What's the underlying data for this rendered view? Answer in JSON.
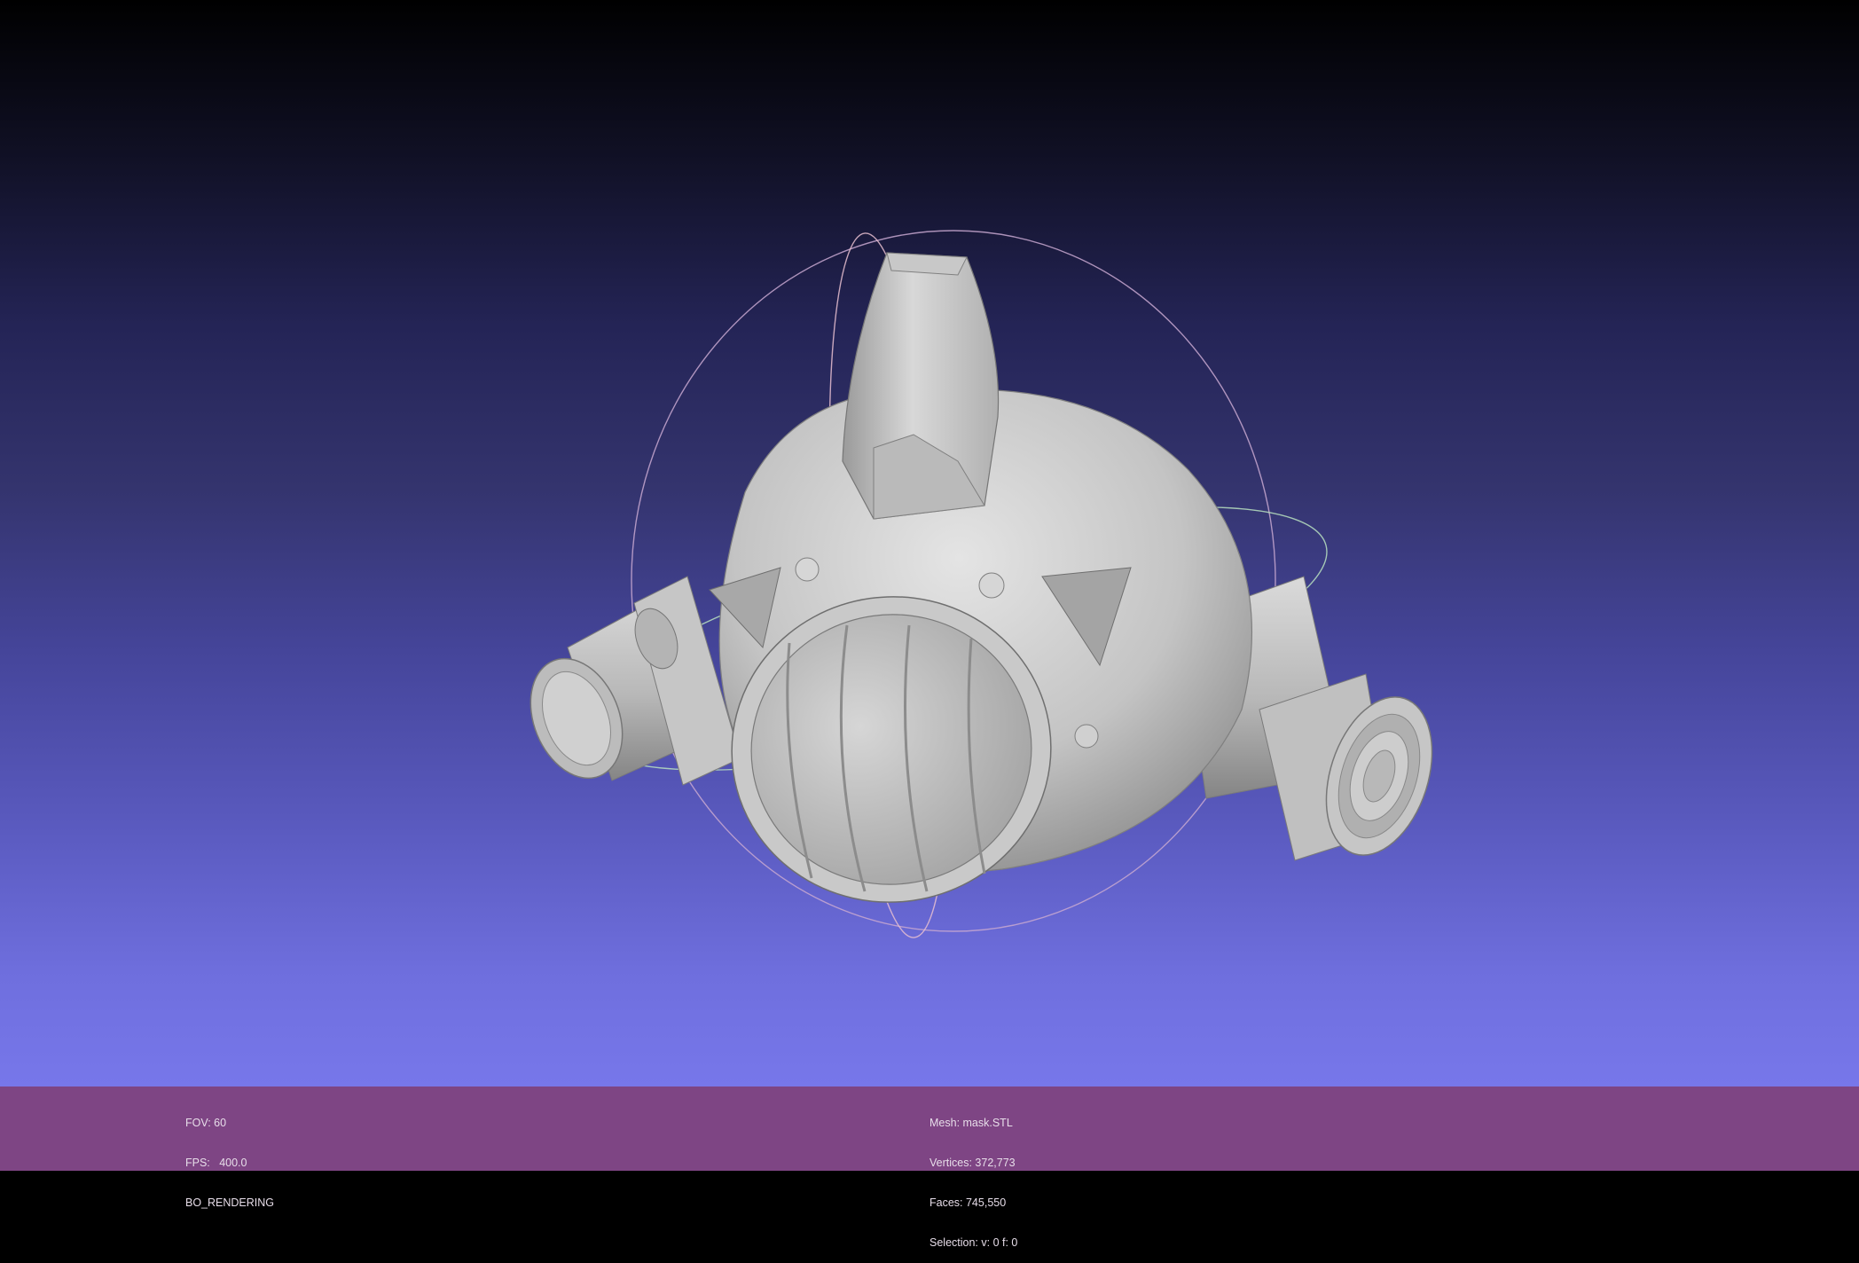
{
  "viewer": {
    "background_top": "#000000",
    "background_bottom": "#7777ea",
    "mesh_color": "#c9c9c9",
    "trackball_colors": [
      "#d8b8d8",
      "#c8e8c8",
      "#e8c8d0"
    ]
  },
  "status_left": {
    "fov": "FOV: 60",
    "fps": "FPS:   400.0",
    "mode": "BO_RENDERING"
  },
  "status_right": {
    "mesh": "Mesh: mask.STL",
    "vertices": "Vertices: 372,773",
    "faces": "Faces: 745,550",
    "selection": "Selection: v: 0 f: 0"
  },
  "status_bar_color": "#7e4584"
}
